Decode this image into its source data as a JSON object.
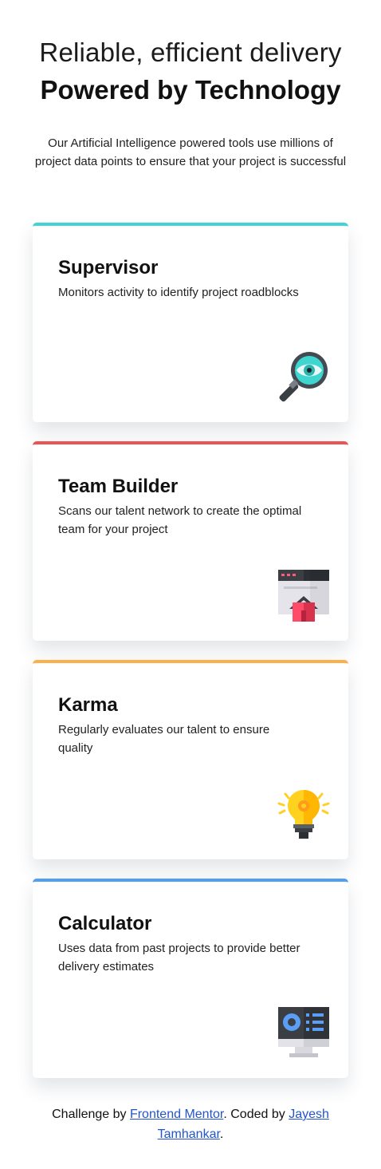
{
  "header": {
    "title_light": "Reliable, efficient delivery",
    "title_bold": "Powered by Technology",
    "intro": "Our Artificial Intelligence powered tools use millions of project data points to ensure that your project is successful"
  },
  "cards": [
    {
      "title": "Supervisor",
      "desc": "Monitors activity to identify project roadblocks",
      "accent": "#44d3d2",
      "icon": "magnifier-eye-icon"
    },
    {
      "title": "Team Builder",
      "desc": "Scans our talent network to create the optimal team for your project",
      "accent": "#ea5454",
      "icon": "team-builder-window-icon"
    },
    {
      "title": "Karma",
      "desc": "Regularly evaluates our talent to ensure quality",
      "accent": "#fcaf4a",
      "icon": "lightbulb-icon"
    },
    {
      "title": "Calculator",
      "desc": "Uses data from past projects to provide better delivery estimates",
      "accent": "#549ef2",
      "icon": "calculator-monitor-icon"
    }
  ],
  "footer": {
    "prefix": "Challenge by ",
    "link1": "Frontend Mentor",
    "middle": ". Coded by ",
    "link2": "Jayesh Tamhankar",
    "suffix": "."
  }
}
